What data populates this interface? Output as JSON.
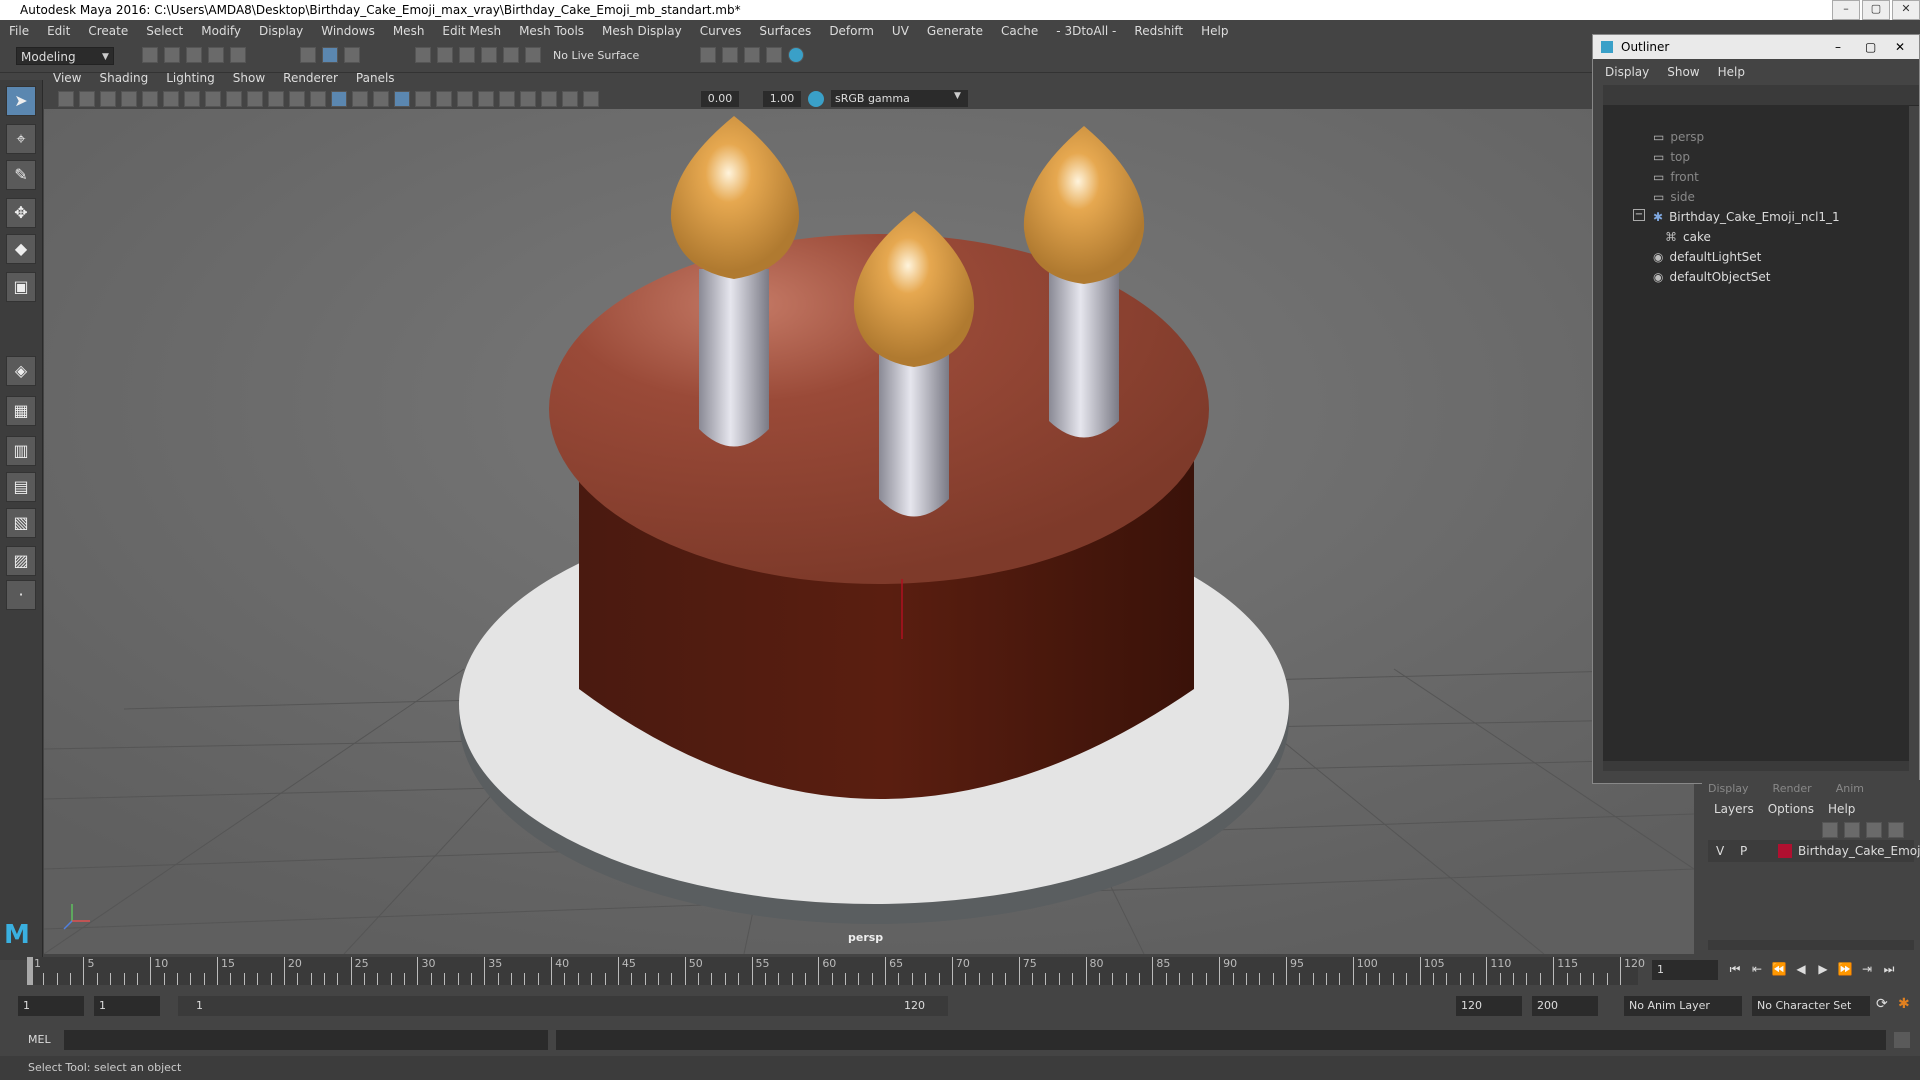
{
  "window": {
    "title": "Autodesk Maya 2016: C:\\Users\\AMDA8\\Desktop\\Birthday_Cake_Emoji_max_vray\\Birthday_Cake_Emoji_mb_standart.mb*",
    "min": "–",
    "max": "▢",
    "close": "✕"
  },
  "menu": [
    "File",
    "Edit",
    "Create",
    "Select",
    "Modify",
    "Display",
    "Windows",
    "Mesh",
    "Edit Mesh",
    "Mesh Tools",
    "Mesh Display",
    "Curves",
    "Surfaces",
    "Deform",
    "UV",
    "Generate",
    "Cache",
    "- 3DtoAll -",
    "Redshift",
    "Help"
  ],
  "shelf": {
    "mode": "Modeling",
    "live_surface": "No Live Surface"
  },
  "panel_menu": [
    "View",
    "Shading",
    "Lighting",
    "Show",
    "Renderer",
    "Panels"
  ],
  "panel_toolbar": {
    "value1": "0.00",
    "value2": "1.00",
    "color_space": "sRGB gamma"
  },
  "viewport": {
    "camera_label": "persp"
  },
  "outliner": {
    "title": "Outliner",
    "menu": [
      "Display",
      "Show",
      "Help"
    ],
    "items": [
      {
        "label": "persp",
        "dim": true
      },
      {
        "label": "top",
        "dim": true
      },
      {
        "label": "front",
        "dim": true
      },
      {
        "label": "side",
        "dim": true
      },
      {
        "label": "Birthday_Cake_Emoji_ncl1_1",
        "dim": false
      },
      {
        "label": "cake",
        "dim": false
      },
      {
        "label": "defaultLightSet",
        "dim": false
      },
      {
        "label": "defaultObjectSet",
        "dim": false
      }
    ]
  },
  "layers": {
    "tabs": [
      "Display",
      "Render",
      "Anim"
    ],
    "menu": [
      "Layers",
      "Options",
      "Help"
    ],
    "row": {
      "v": "V",
      "p": "P",
      "name": "Birthday_Cake_Emoji",
      "color": "#b01030"
    }
  },
  "timeline": {
    "labels": [
      "1",
      "5",
      "10",
      "15",
      "20",
      "25",
      "30",
      "35",
      "40",
      "45",
      "50",
      "55",
      "60",
      "65",
      "70",
      "75",
      "80",
      "85",
      "90",
      "95",
      "100",
      "105",
      "110",
      "115",
      "120"
    ],
    "current_frame": "1"
  },
  "range": {
    "start": "1",
    "start2": "1",
    "slider_start": "1",
    "slider_end": "120",
    "end": "120",
    "end2": "200",
    "anim_layer": "No Anim Layer",
    "char_set": "No Character Set"
  },
  "mel": {
    "label": "MEL"
  },
  "status": {
    "text": "Select Tool: select an object"
  }
}
